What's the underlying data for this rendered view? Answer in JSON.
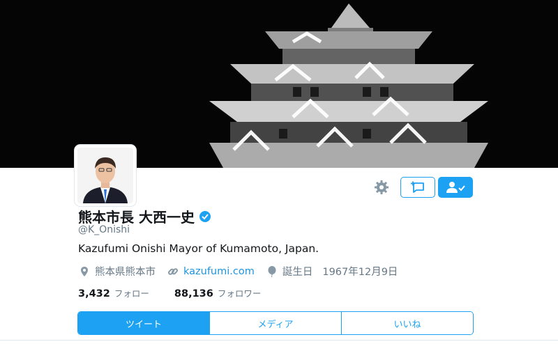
{
  "profile": {
    "name": "熊本市長 大西一史",
    "handle": "@K_Onishi",
    "bio": "Kazufumi Onishi Mayor of Kumamoto, Japan.",
    "location": "熊本県熊本市",
    "website": "kazufumi.com",
    "birthday_label": "誕生日",
    "birthday": "1967年12月9日",
    "verified": true
  },
  "stats": {
    "following_count": "3,432",
    "following_label": "フォロー",
    "followers_count": "88,136",
    "followers_label": "フォロワー"
  },
  "tabs": [
    {
      "label": "ツイート",
      "active": true
    },
    {
      "label": "メディア",
      "active": false
    },
    {
      "label": "いいね",
      "active": false
    }
  ],
  "icons": {
    "settings": "gear-icon",
    "message": "message-add-icon",
    "follow": "user-following-icon",
    "location": "location-pin-icon",
    "link": "link-icon",
    "birthday": "balloon-icon",
    "verified": "verified-badge-icon"
  },
  "colors": {
    "accent": "#1da1f2",
    "link": "#1b95e0",
    "secondary_text": "#657786",
    "header_bg": "#050505"
  }
}
